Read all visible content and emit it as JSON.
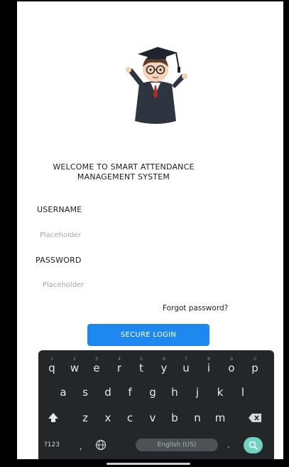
{
  "welcome": {
    "line1": "WELCOME TO SMART ATTENDANCE",
    "line2": "MANAGEMENT SYSTEM"
  },
  "form": {
    "username_label": "USERNAME",
    "username_placeholder": "Placeholder",
    "password_label": "PASSWORD",
    "password_placeholder": "Placeholder",
    "forgot_password": "Forgot password?",
    "login_button": "SECURE LOGIN"
  },
  "keyboard": {
    "row1": [
      "q",
      "w",
      "e",
      "r",
      "t",
      "y",
      "u",
      "i",
      "o",
      "p"
    ],
    "row1_hints": [
      "1",
      "2",
      "3",
      "4",
      "5",
      "6",
      "7",
      "8",
      "9",
      "0"
    ],
    "row2": [
      "a",
      "s",
      "d",
      "f",
      "g",
      "h",
      "j",
      "k",
      "l"
    ],
    "row3": [
      "z",
      "x",
      "c",
      "v",
      "b",
      "n",
      "m"
    ],
    "symbols_key": "?123",
    "comma_key": ",",
    "space_label": "English (US)",
    "period_key": ".",
    "icons": {
      "shift": "shift-icon",
      "backspace": "backspace-icon",
      "globe": "globe-icon",
      "search": "search-icon"
    }
  },
  "colors": {
    "primary": "#1e88f0",
    "keyboard_bg": "#23272a",
    "search_key": "#6fd3c2"
  }
}
